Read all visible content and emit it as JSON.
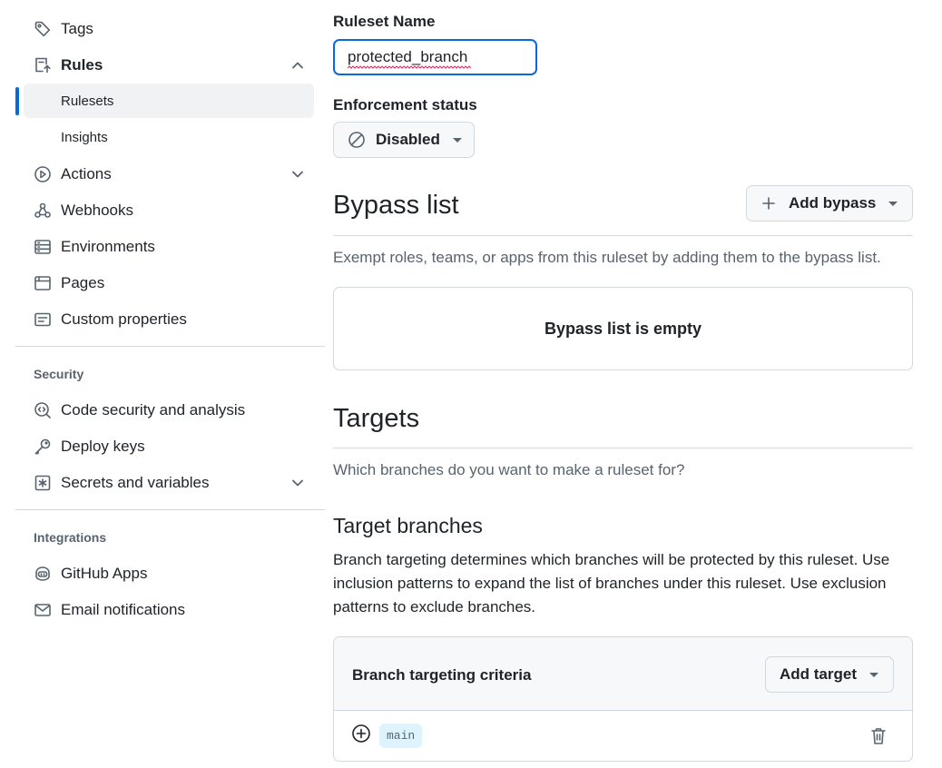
{
  "sidebar": {
    "items": [
      {
        "label": "Tags",
        "icon": "tag-icon"
      },
      {
        "label": "Rules",
        "icon": "rules-icon"
      },
      {
        "label": "Rulesets"
      },
      {
        "label": "Insights"
      },
      {
        "label": "Actions",
        "icon": "play-icon"
      },
      {
        "label": "Webhooks",
        "icon": "webhook-icon"
      },
      {
        "label": "Environments",
        "icon": "server-icon"
      },
      {
        "label": "Pages",
        "icon": "browser-icon"
      },
      {
        "label": "Custom properties",
        "icon": "note-icon"
      }
    ],
    "security_heading": "Security",
    "security_items": [
      {
        "label": "Code security and analysis",
        "icon": "codescan-icon"
      },
      {
        "label": "Deploy keys",
        "icon": "key-icon"
      },
      {
        "label": "Secrets and variables",
        "icon": "asterisk-icon"
      }
    ],
    "integrations_heading": "Integrations",
    "integrations_items": [
      {
        "label": "GitHub Apps",
        "icon": "copilot-icon"
      },
      {
        "label": "Email notifications",
        "icon": "mail-icon"
      }
    ]
  },
  "form": {
    "name_label": "Ruleset Name",
    "name_value": "protected_branch",
    "enforcement_label": "Enforcement status",
    "enforcement_value": "Disabled"
  },
  "bypass": {
    "title": "Bypass list",
    "add_button": "Add bypass",
    "description": "Exempt roles, teams, or apps from this ruleset by adding them to the bypass list.",
    "empty_text": "Bypass list is empty"
  },
  "targets": {
    "title": "Targets",
    "description": "Which branches do you want to make a ruleset for?",
    "branches_title": "Target branches",
    "branches_description": "Branch targeting determines which branches will be protected by this ruleset. Use inclusion patterns to expand the list of branches under this ruleset. Use exclusion patterns to exclude branches.",
    "criteria_title": "Branch targeting criteria",
    "add_target_button": "Add target",
    "branch_pattern": "main"
  },
  "colors": {
    "accent": "#0969da",
    "muted": "#59636e",
    "border": "#d1d9e0",
    "branch_tag_bg": "#ddf4ff"
  }
}
